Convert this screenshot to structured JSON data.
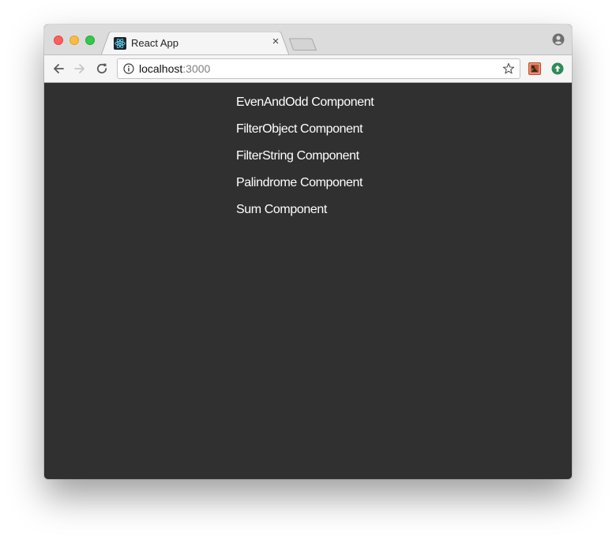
{
  "browser": {
    "tab": {
      "title": "React App",
      "close_label": "×"
    },
    "address_bar": {
      "host": "localhost",
      "port": ":3000"
    },
    "icons": {
      "profile": "account-circle-icon",
      "back": "arrow-left-icon",
      "forward": "arrow-right-icon",
      "reload": "reload-icon",
      "info": "info-icon",
      "bookmark": "star-icon",
      "extension_1": "extension-icon",
      "extension_2": "upload-circle-icon"
    },
    "colors": {
      "titlebar": "#dcdcdc",
      "toolbar": "#f5f5f5",
      "page_background": "#303030",
      "menu_text": "#ffffff",
      "traffic_close": "#fc605c",
      "traffic_minimize": "#fdbc40",
      "traffic_maximize": "#34c84a"
    }
  },
  "page": {
    "components": [
      {
        "label": "EvenAndOdd Component"
      },
      {
        "label": "FilterObject Component"
      },
      {
        "label": "FilterString Component"
      },
      {
        "label": "Palindrome Component"
      },
      {
        "label": "Sum Component"
      }
    ]
  }
}
